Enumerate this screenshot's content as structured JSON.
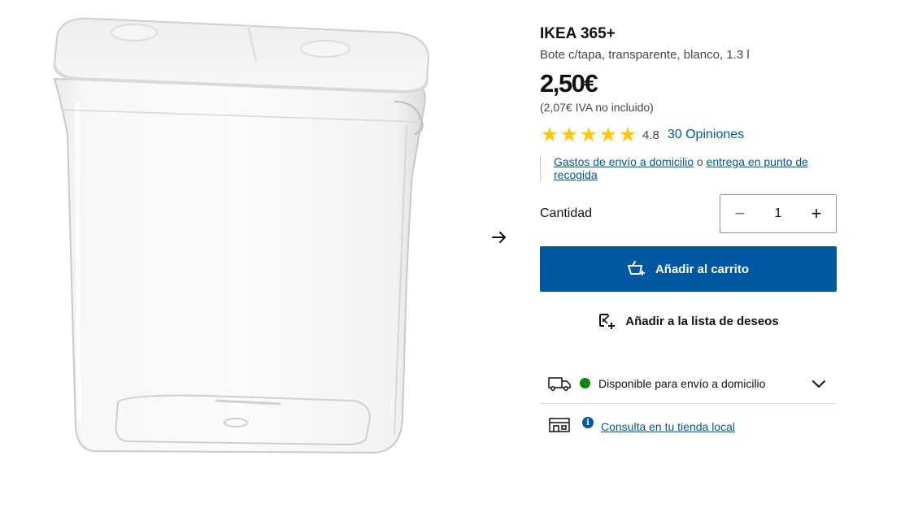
{
  "product": {
    "brand": "IKEA 365+",
    "description": "Bote c/tapa, transparente, blanco, 1.3 l",
    "price": "2,50€",
    "vat_note": "(2,07€ IVA no incluido)",
    "image_alt": "Bote transparente con tapa blanca"
  },
  "rating": {
    "value": "4.8",
    "stars": 5,
    "reviews_label": "30 Opiniones"
  },
  "delivery_note": {
    "link1": "Gastos de envío a domicilio",
    "separator": " o ",
    "link2": "entrega en punto de recogida"
  },
  "quantity": {
    "label": "Cantidad",
    "value": "1",
    "minus": "−",
    "plus": "+"
  },
  "buttons": {
    "add_to_cart": "Añadir al carrito",
    "add_to_wishlist": "Añadir a la lista de deseos"
  },
  "availability": {
    "home_delivery": "Disponible para envío a domicilio",
    "store_link": "Consulta en tu tienda local",
    "info_symbol": "i"
  },
  "colors": {
    "primary_blue": "#0058a3",
    "star_yellow": "#ffc800",
    "available_green": "#0a8a00"
  },
  "icons": {
    "next": "arrow-right-icon",
    "cart": "shopping-basket-icon",
    "wishlist": "heart-list-icon",
    "truck": "truck-icon",
    "store": "store-icon",
    "chevron": "chevron-down-icon",
    "info": "info-icon"
  }
}
